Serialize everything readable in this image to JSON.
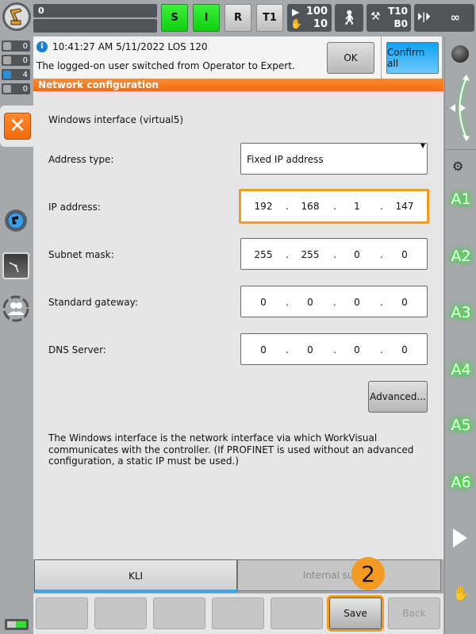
{
  "header": {
    "program_line1": "0",
    "program_line2": "",
    "modes": [
      {
        "label": "S",
        "state": "active",
        "color": "#22e022"
      },
      {
        "label": "I",
        "state": "active",
        "color": "#22e022"
      },
      {
        "label": "R",
        "state": "inactive"
      },
      {
        "label": "T1",
        "state": "inactive"
      }
    ],
    "override_program": "100",
    "override_jog": "10",
    "tool_label": "T10",
    "base_label": "B0",
    "increment": "∞"
  },
  "message_counts": [
    {
      "type": "acknowledgement",
      "count": "0"
    },
    {
      "type": "status",
      "count": "0"
    },
    {
      "type": "info",
      "count": "4"
    },
    {
      "type": "wait",
      "count": "0"
    }
  ],
  "message": {
    "timestamp": "10:41:27 AM 5/11/2022 LOS 120",
    "text": "The logged-on user switched from Operator to Expert.",
    "ok_label": "OK",
    "confirm_all_label": "Confirm all"
  },
  "panel": {
    "title": "Network configuration",
    "interface_label": "Windows interface (virtual5)",
    "address_type": {
      "label": "Address type:",
      "value": "Fixed IP address"
    },
    "ip_address": {
      "label": "IP address:",
      "octets": [
        "192",
        "168",
        "1",
        "147"
      ]
    },
    "subnet_mask": {
      "label": "Subnet mask:",
      "octets": [
        "255",
        "255",
        "0",
        "0"
      ]
    },
    "standard_gateway": {
      "label": "Standard gateway:",
      "octets": [
        "0",
        "0",
        "0",
        "0"
      ]
    },
    "dns_server": {
      "label": "DNS Server:",
      "octets": [
        "0",
        "0",
        "0",
        "0"
      ]
    },
    "advanced_label": "Advanced...",
    "info_text": "The Windows interface is the network interface via which WorkVisual communicates with the controller. (If PROFINET is used without an advanced configuration, a static IP must be used.)"
  },
  "tabs": [
    {
      "label": "KLI",
      "active": true
    },
    {
      "label": "Internal sub",
      "active": false
    }
  ],
  "softkeys": {
    "save_label": "Save",
    "back_label": "Back"
  },
  "annotation": {
    "step_badge": "2",
    "color": "#f39a23"
  },
  "right_bar": {
    "axes": [
      "A1",
      "A2",
      "A3",
      "A4",
      "A5",
      "A6"
    ]
  },
  "colors": {
    "accent_orange": "#f46b0c",
    "highlight_orange": "#f39a23",
    "confirm_blue": "#0ea3f5",
    "axis_green": "#2aff2a"
  }
}
